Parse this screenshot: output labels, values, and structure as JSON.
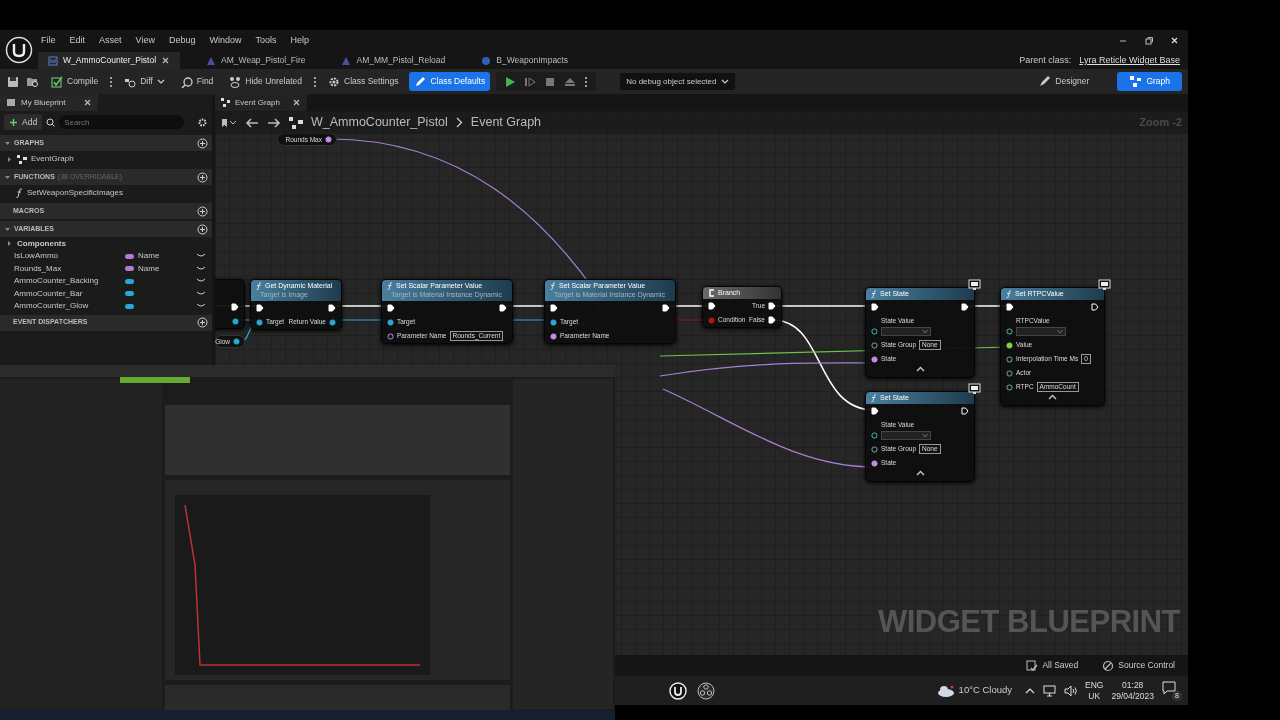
{
  "menu": [
    "File",
    "Edit",
    "Asset",
    "View",
    "Debug",
    "Window",
    "Tools",
    "Help"
  ],
  "document_tabs": [
    {
      "label": "W_AmmoCounter_Pistol",
      "selected": true
    },
    {
      "label": "AM_Weap_Pistol_Fire",
      "selected": false
    },
    {
      "label": "AM_MM_Pistol_Reload",
      "selected": false
    },
    {
      "label": "B_WeaponImpacts",
      "selected": false
    }
  ],
  "parent_class": {
    "label": "Parent class:",
    "value": "Lyra Reticle Widget Base"
  },
  "toolbar": {
    "buttons": [
      {
        "label": "Compile",
        "kind": "split",
        "active": false
      },
      {
        "label": "Diff",
        "kind": "dropdown",
        "active": false
      },
      {
        "label": "Find",
        "kind": "plain",
        "active": false
      },
      {
        "label": "Hide Unrelated",
        "kind": "split",
        "active": false
      },
      {
        "label": "Class Settings",
        "kind": "plain",
        "active": false
      },
      {
        "label": "Class Defaults",
        "kind": "plain",
        "active": true
      }
    ],
    "debug_object": "No debug object selected",
    "modes": [
      {
        "label": "Designer",
        "selected": false
      },
      {
        "label": "Graph",
        "selected": true
      }
    ]
  },
  "my_blueprint": {
    "tab": "My Blueprint",
    "add": "Add",
    "search": {
      "placeholder": "Search"
    },
    "sections": [
      {
        "title": "GRAPHS",
        "expanded": true,
        "items": [
          {
            "kind": "graph",
            "label": "EventGraph",
            "expanded": false
          }
        ]
      },
      {
        "title": "FUNCTIONS",
        "count": "(38 OVERRIDABLE)",
        "expanded": true,
        "items": [
          {
            "kind": "function",
            "label": "SetWeaponSpecificImages"
          }
        ]
      },
      {
        "title": "MACROS"
      },
      {
        "title": "VARIABLES",
        "expanded": true,
        "items": [
          {
            "kind": "category",
            "label": "Components",
            "expanded": false
          },
          {
            "kind": "variable",
            "label": "IsLowAmmo",
            "type": "Name",
            "color": "#b678d6"
          },
          {
            "kind": "variable",
            "label": "Rounds_Max",
            "type": "Name",
            "color": "#b678d6"
          },
          {
            "kind": "variable",
            "label": "AmmoCounter_Backing",
            "color": "#2aa7d6"
          },
          {
            "kind": "variable",
            "label": "AmmoCounter_Bar",
            "color": "#2aa7d6"
          },
          {
            "kind": "variable",
            "label": "AmmoCounter_Glow",
            "color": "#2aa7d6"
          }
        ]
      },
      {
        "title": "EVENT DISPATCHERS"
      }
    ]
  },
  "graph": {
    "tab": "Event Graph",
    "breadcrumb": [
      "W_AmmoCounter_Pistol",
      "Event Graph"
    ],
    "zoom": "Zoom -2",
    "nodes": [
      {
        "kind": "variable",
        "title": "Rounds Max",
        "pin": {
          "kind": "name",
          "connected": true
        }
      },
      {
        "kind": "stub",
        "rows": [
          {
            "out": {
              "kind": "exec",
              "connected": true
            }
          },
          {
            "out": {
              "kind": "object",
              "connected": true
            }
          }
        ]
      },
      {
        "kind": "variable",
        "title": "Glow",
        "pin": {
          "kind": "object",
          "connected": true
        }
      },
      {
        "kind": "function",
        "title": "Get Dynamic Material",
        "subtitle": "Target is Image",
        "rows": [
          {
            "in": {
              "kind": "exec",
              "connected": true
            },
            "out": {
              "kind": "exec",
              "connected": true
            }
          },
          {
            "in": {
              "kind": "object",
              "label": "Target",
              "connected": true
            },
            "out": {
              "kind": "object",
              "label": "Return Value",
              "connected": true
            }
          }
        ]
      },
      {
        "kind": "function",
        "title": "Set Scalar Parameter Value",
        "subtitle": "Target is Material Instance Dynamic",
        "rows": [
          {
            "in": {
              "kind": "exec",
              "connected": true
            },
            "out": {
              "kind": "exec",
              "connected": true
            }
          },
          {
            "in": {
              "kind": "object",
              "label": "Target",
              "connected": true
            }
          },
          {
            "in": {
              "kind": "name",
              "label": "Parameter Name",
              "value": "Rounds_Current",
              "connected": false
            }
          }
        ]
      },
      {
        "kind": "function",
        "title": "Set Scalar Parameter Value",
        "subtitle": "Target is Material Instance Dynamic",
        "rows": [
          {
            "in": {
              "kind": "exec",
              "connected": true
            },
            "out": {
              "kind": "exec",
              "connected": true
            }
          },
          {
            "in": {
              "kind": "object",
              "label": "Target",
              "connected": true
            }
          },
          {
            "in": {
              "kind": "name",
              "label": "Parameter Name",
              "connected": true
            }
          }
        ]
      },
      {
        "kind": "branch",
        "title": "Branch",
        "rows": [
          {
            "in": {
              "kind": "exec",
              "connected": true
            },
            "out": {
              "kind": "exec",
              "label": "True",
              "connected": true
            }
          },
          {
            "in": {
              "kind": "bool",
              "label": "Condition",
              "connected": true
            },
            "out": {
              "kind": "exec",
              "label": "False",
              "connected": true
            }
          }
        ]
      },
      {
        "kind": "client_function",
        "title": "Set State",
        "rows": [
          {
            "in": {
              "kind": "exec",
              "connected": true
            },
            "out": {
              "kind": "exec",
              "connected": true
            }
          },
          {
            "in": {
              "kind": "enum",
              "label": "State Value",
              "connected": false
            }
          },
          {
            "in": {
              "kind": "ref",
              "label": "State Group",
              "value": "None",
              "connected": false
            }
          },
          {
            "in": {
              "kind": "name",
              "label": "State",
              "connected": true
            }
          }
        ]
      },
      {
        "kind": "client_function",
        "title": "Set State",
        "rows": [
          {
            "in": {
              "kind": "exec",
              "connected": true
            },
            "out": {
              "kind": "exec",
              "connected": false
            }
          },
          {
            "in": {
              "kind": "enum",
              "label": "State Value",
              "connected": false
            }
          },
          {
            "in": {
              "kind": "ref",
              "label": "State Group",
              "value": "None",
              "connected": false
            }
          },
          {
            "in": {
              "kind": "name",
              "label": "State",
              "connected": true
            }
          }
        ]
      },
      {
        "kind": "client_function",
        "title": "Set RTPCValue",
        "rows": [
          {
            "in": {
              "kind": "exec",
              "connected": true
            },
            "out": {
              "kind": "exec",
              "connected": false
            }
          },
          {
            "in": {
              "kind": "enum",
              "label": "RTPCValue",
              "connected": false
            }
          },
          {
            "in": {
              "kind": "float",
              "label": "Value",
              "connected": true
            }
          },
          {
            "in": {
              "kind": "ref",
              "label": "Interpolation Time Ms",
              "value": "0",
              "connected": false
            }
          },
          {
            "in": {
              "kind": "ref",
              "label": "Actor",
              "connected": false
            }
          },
          {
            "in": {
              "kind": "ref",
              "label": "RTPC",
              "value": "AmmoCount",
              "connected": false
            }
          }
        ]
      }
    ],
    "label": "WIDGET BLUEPRINT"
  },
  "status": [
    "All Saved",
    "Source Control"
  ],
  "inset": {
    "kind": "picture"
  },
  "taskbar": {
    "weather": "10°C Cloudy",
    "language": "ENG",
    "region": "UK",
    "time": "01:28",
    "date": "29/04/2023",
    "notifications": "8"
  }
}
